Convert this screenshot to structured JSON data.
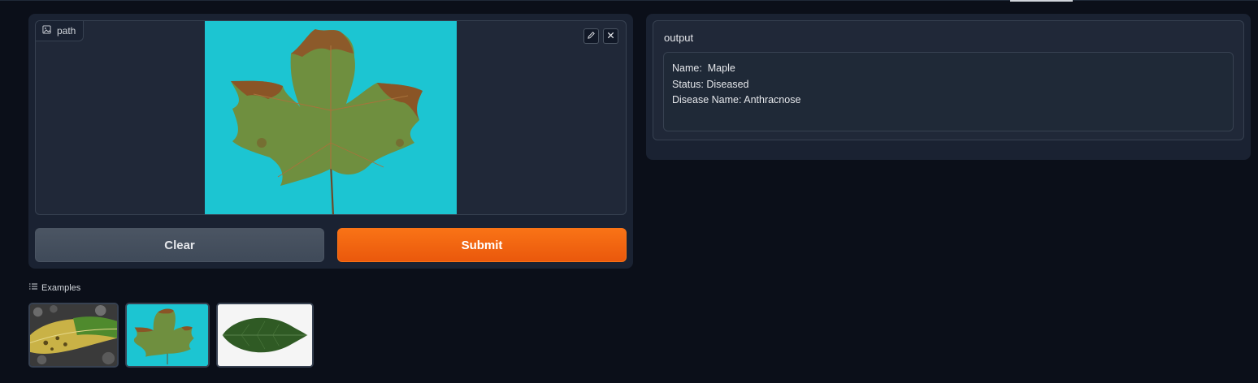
{
  "input": {
    "label": "path",
    "clear_label": "Clear",
    "submit_label": "Submit",
    "icons": [
      "image-icon",
      "edit-icon",
      "close-icon"
    ]
  },
  "examples": {
    "title": "Examples",
    "items": [
      {
        "name": "yellow-spotted-leaf"
      },
      {
        "name": "maple-leaf-cyan"
      },
      {
        "name": "green-leaf-white"
      }
    ]
  },
  "output": {
    "label": "output",
    "lines": [
      "Name:  Maple",
      "Status: Diseased",
      "Disease Name: Anthracnose"
    ]
  },
  "colors": {
    "background": "#0b0f19",
    "panel": "#1a2232",
    "accent": "#f97316",
    "image_bg": "#1cc5d2"
  }
}
